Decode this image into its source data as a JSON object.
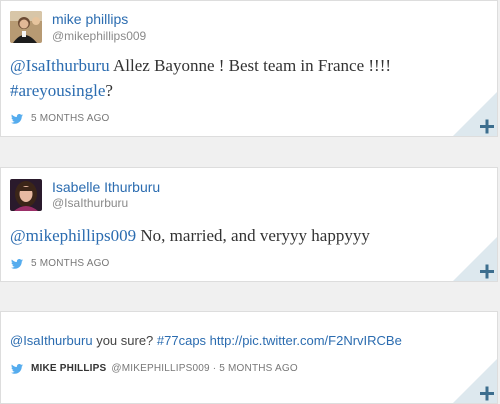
{
  "tweets": [
    {
      "name": "mike phillips",
      "handle": "@mikephillips009",
      "text_mention": "@IsaIthurburu",
      "text_body": " Allez Bayonne ! Best team in France !!!! ",
      "text_hashtag": "#areyousingle",
      "text_tail": "?",
      "time": "5 MONTHS AGO",
      "icons": {
        "avatar": "avatar-photo",
        "bird": "twitter-bird-icon",
        "expand": "plus-icon"
      }
    },
    {
      "name": "Isabelle Ithurburu",
      "handle": "@IsaIthurburu",
      "text_mention": "@mikephillips009",
      "text_body": " No, married, and veryyy happyyy",
      "time": "5 MONTHS AGO",
      "icons": {
        "avatar": "avatar-photo",
        "bird": "twitter-bird-icon",
        "expand": "plus-icon"
      }
    },
    {
      "text_mention": "@IsaIthurburu",
      "text_body": " you sure? ",
      "text_hashtag": "#77caps",
      "text_url": " http://pic.twitter.com/F2NrvIRCBe",
      "author": "MIKE PHILLIPS",
      "meta_rest": "@MIKEPHILLIPS009 · 5 MONTHS AGO",
      "icons": {
        "bird": "twitter-bird-icon",
        "expand": "plus-icon"
      }
    }
  ],
  "colors": {
    "link": "#2b6cb0",
    "bird": "#55acee",
    "plus": "#3d6e8e",
    "corner_fold": "#dde8ee",
    "background": "#f0f0f0"
  }
}
